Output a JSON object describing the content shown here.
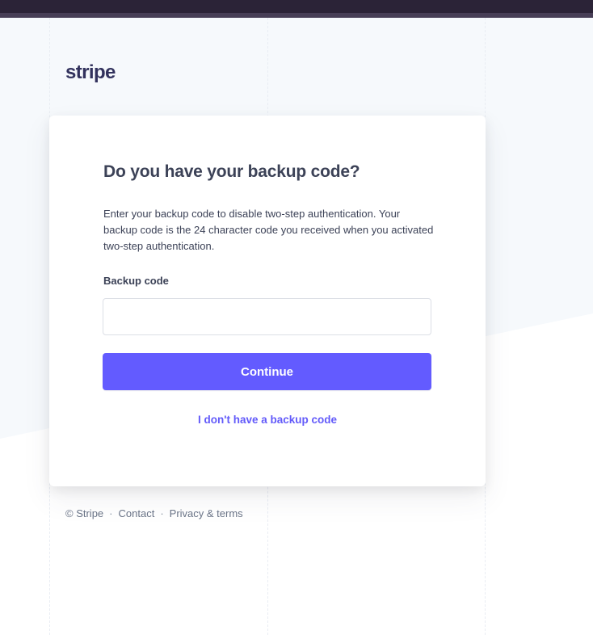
{
  "brand": {
    "logo_text": "stripe"
  },
  "card": {
    "title": "Do you have your backup code?",
    "description": "Enter your backup code to disable two-step authentication. Your backup code is the 24 character code you received when you activated two-step authentication.",
    "backup_code_label": "Backup code",
    "backup_code_value": "",
    "continue_label": "Continue",
    "no_code_link": "I don't have a backup code"
  },
  "footer": {
    "copyright": "© Stripe",
    "separator": "·",
    "contact": "Contact",
    "privacy": "Privacy & terms"
  },
  "colors": {
    "accent": "#635bff",
    "link": "#625afa",
    "topbar": "#2b2337",
    "background_tint": "#f6f9fc",
    "text": "#3c4257",
    "muted": "#697386"
  }
}
